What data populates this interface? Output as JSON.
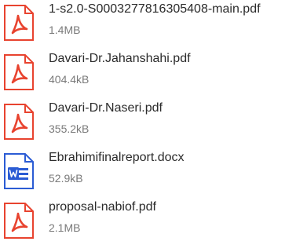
{
  "colors": {
    "pdf_accent": "#e8432f",
    "docx_accent": "#2b5cd4",
    "name_text": "#2b2b2b",
    "size_text": "#7a7a7a"
  },
  "files": [
    {
      "name": "1-s2.0-S0003277816305408-main.pdf",
      "size": "1.4MB",
      "icon": "pdf-icon"
    },
    {
      "name": "Davari-Dr.Jahanshahi.pdf",
      "size": "404.4kB",
      "icon": "pdf-icon"
    },
    {
      "name": "Davari-Dr.Naseri.pdf",
      "size": "355.2kB",
      "icon": "pdf-icon"
    },
    {
      "name": "Ebrahimifinalreport.docx",
      "size": "52.9kB",
      "icon": "word-doc-icon"
    },
    {
      "name": "proposal-nabiof.pdf",
      "size": "2.1MB",
      "icon": "pdf-icon"
    }
  ]
}
